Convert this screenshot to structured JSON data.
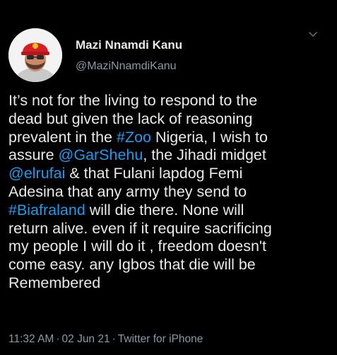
{
  "author": {
    "display_name": "Mazi Nnamdi Kanu",
    "handle": "@MaziNnamdiKanu",
    "avatar_icon": "profile-photo-avatar"
  },
  "tweet": {
    "lines": [
      [
        {
          "text": "It’s not for the living to respond to the",
          "link": false
        }
      ],
      [
        {
          "text": "dead but given the lack of reasoning",
          "link": false
        }
      ],
      [
        {
          "text": "prevalent in the ",
          "link": false
        },
        {
          "text": "#Zoo",
          "link": true
        },
        {
          "text": " Nigeria, I wish to",
          "link": false
        }
      ],
      [
        {
          "text": "assure ",
          "link": false
        },
        {
          "text": "@GarShehu",
          "link": true
        },
        {
          "text": ", the Jihadi midget",
          "link": false
        }
      ],
      [
        {
          "text": "@elrufai",
          "link": true
        },
        {
          "text": " & that Fulani lapdog Femi",
          "link": false
        }
      ],
      [
        {
          "text": "Adesina that any army they send to",
          "link": false
        }
      ],
      [
        {
          "text": "#Biafraland",
          "link": true
        },
        {
          "text": " will die there. None will",
          "link": false
        }
      ],
      [
        {
          "text": "return alive. even if it require sacrificing",
          "link": false
        }
      ],
      [
        {
          "text": "my people I will do it , freedom doesn't",
          "link": false
        }
      ],
      [
        {
          "text": "come easy. any Igbos that die will be",
          "link": false
        }
      ],
      [
        {
          "text": "Remembered",
          "link": false
        }
      ]
    ]
  },
  "meta": {
    "time": "11:32 AM",
    "separator": "·",
    "date": "02 Jun 21",
    "source": "Twitter for iPhone"
  },
  "icons": {
    "more": "chevron-down-icon"
  },
  "colors": {
    "background": "#000000",
    "text": "#e7e9ea",
    "secondary": "#8b98a5",
    "link": "#1d9bf0"
  }
}
